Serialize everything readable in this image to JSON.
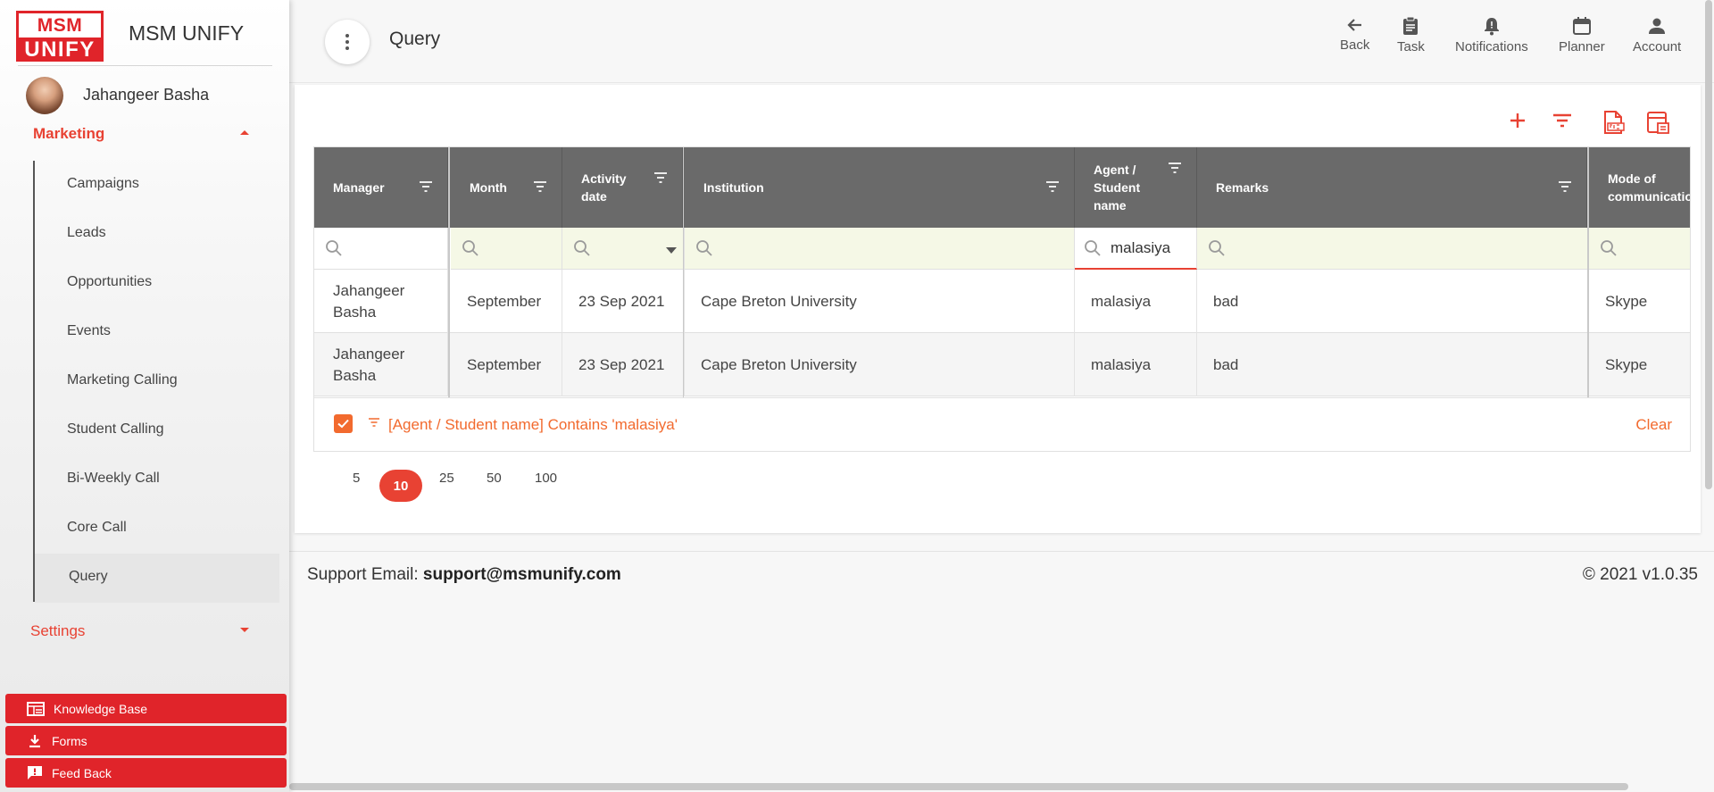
{
  "app": {
    "brand_top": "MSM",
    "brand_bottom": "UNIFY",
    "brand_name": "MSM UNIFY",
    "user_name": "Jahangeer Basha"
  },
  "sidebar": {
    "section_marketing": "Marketing",
    "items": [
      {
        "label": "Campaigns"
      },
      {
        "label": "Leads"
      },
      {
        "label": "Opportunities"
      },
      {
        "label": "Events"
      },
      {
        "label": "Marketing Calling"
      },
      {
        "label": "Student Calling"
      },
      {
        "label": "Bi-Weekly Call"
      },
      {
        "label": "Core Call"
      },
      {
        "label": "Query"
      }
    ],
    "active_item": "Query",
    "section_settings": "Settings",
    "buttons": [
      {
        "label": "Knowledge Base",
        "icon": "book-icon"
      },
      {
        "label": "Forms",
        "icon": "download-icon"
      },
      {
        "label": "Feed Back",
        "icon": "feedback-icon"
      }
    ]
  },
  "header": {
    "title": "Query",
    "actions": [
      {
        "label": "Back",
        "icon": "arrow-left-icon"
      },
      {
        "label": "Task",
        "icon": "clipboard-icon"
      },
      {
        "label": "Notifications",
        "icon": "bell-icon"
      },
      {
        "label": "Planner",
        "icon": "calendar-icon"
      },
      {
        "label": "Account",
        "icon": "person-icon"
      }
    ]
  },
  "toolbar": {
    "icons": [
      "add-icon",
      "filter-icon",
      "export-pdf-icon",
      "column-chooser-icon"
    ]
  },
  "grid": {
    "columns": [
      {
        "label": "Manager"
      },
      {
        "label": "Month"
      },
      {
        "label": "Activity date"
      },
      {
        "label": "Institution"
      },
      {
        "label": "Agent / Student name"
      },
      {
        "label": "Remarks"
      },
      {
        "label": "Mode of communication"
      }
    ],
    "filter_value": "malasiya",
    "rows": [
      {
        "manager": "Jahangeer Basha",
        "month": "September",
        "activity_date": "23 Sep 2021",
        "institution": "Cape Breton University",
        "agent": "malasiya",
        "remarks": "bad",
        "mode": "Skype"
      },
      {
        "manager": "Jahangeer Basha",
        "month": "September",
        "activity_date": "23 Sep 2021",
        "institution": "Cape Breton University",
        "agent": "malasiya",
        "remarks": "bad",
        "mode": "Skype"
      }
    ],
    "filter_summary": "[Agent / Student name] Contains 'malasiya'",
    "clear_label": "Clear"
  },
  "pager": {
    "sizes": [
      "5",
      "10",
      "25",
      "50",
      "100"
    ],
    "selected": "10"
  },
  "footer": {
    "support_label": "Support Email:",
    "support_email": "support@msmunify.com",
    "copyright": "© 2021 v1.0.35"
  },
  "colors": {
    "accent": "#e84233",
    "brand_red": "#e0242a",
    "header_grey": "#6a6a6a",
    "filter_row_bg": "#f5f8e6"
  }
}
